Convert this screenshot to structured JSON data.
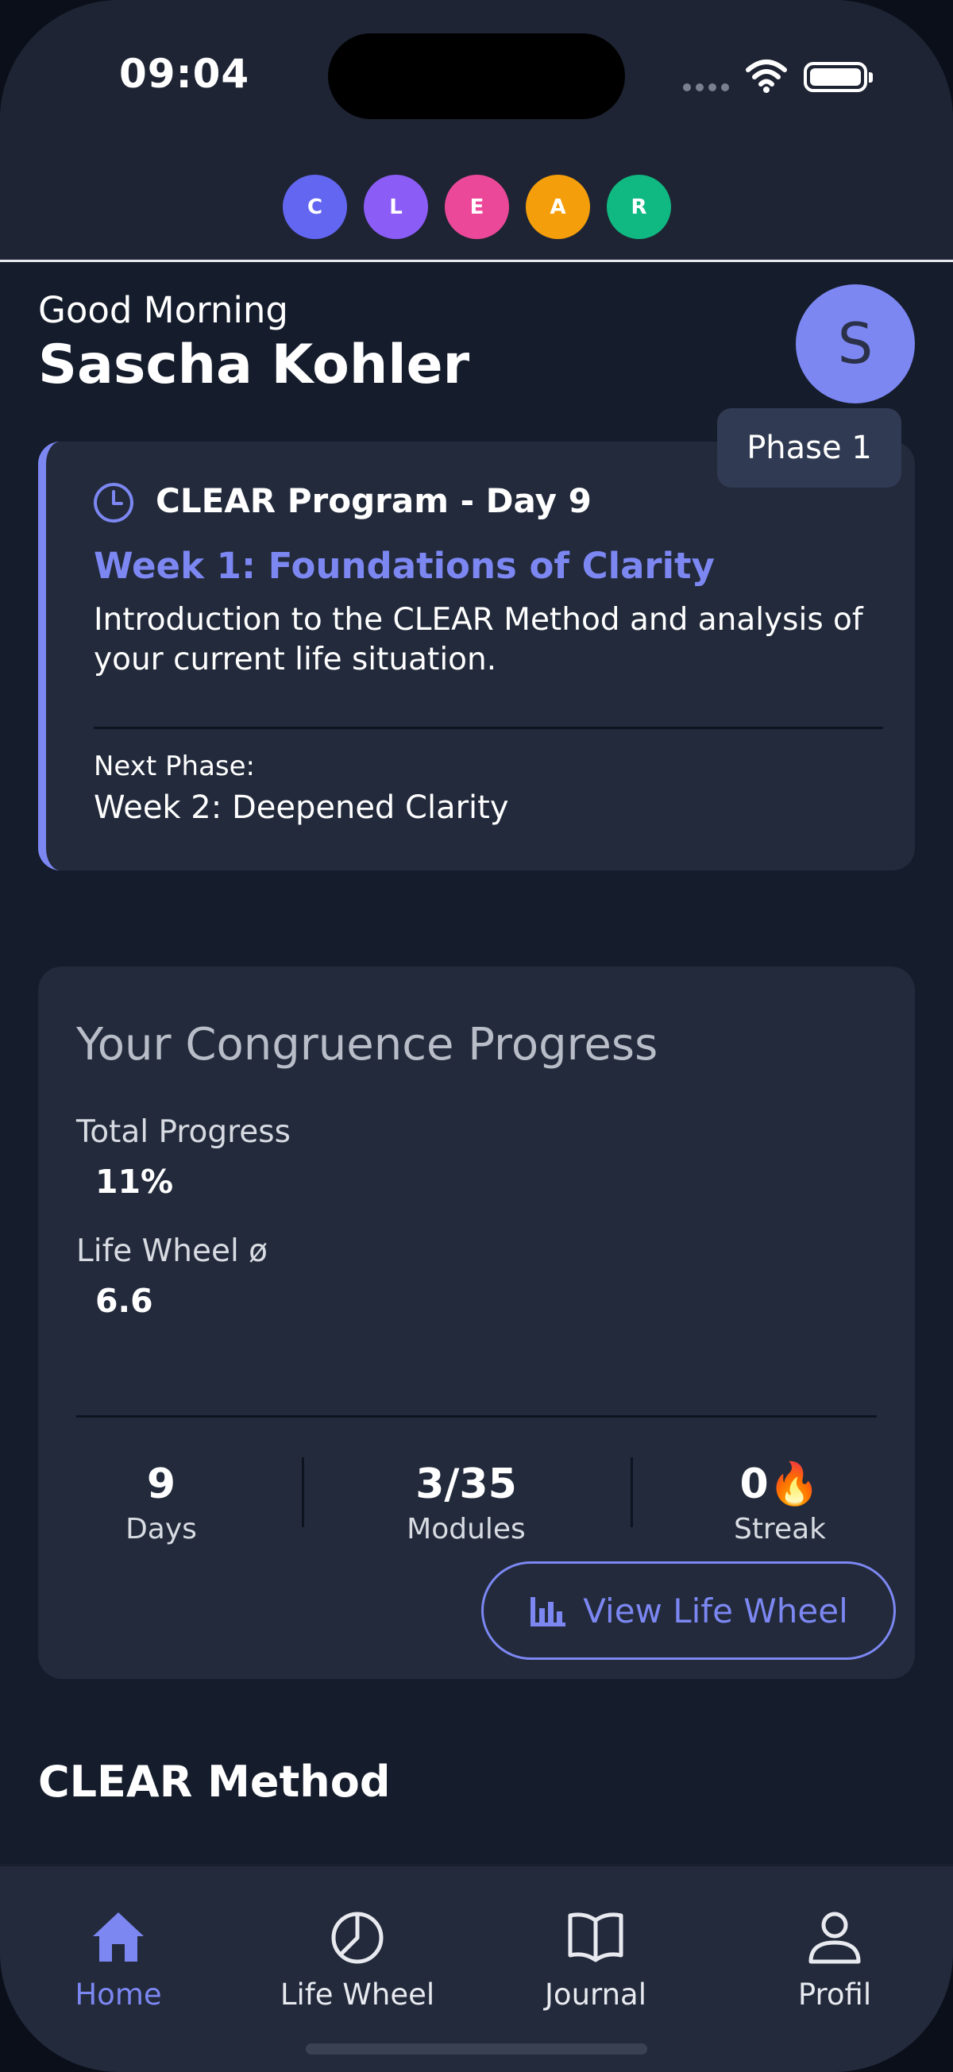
{
  "status_bar": {
    "time": "09:04"
  },
  "method_circles": [
    {
      "letter": "C",
      "color": "#6366f1"
    },
    {
      "letter": "L",
      "color": "#8b5cf6"
    },
    {
      "letter": "E",
      "color": "#ec4899"
    },
    {
      "letter": "A",
      "color": "#f59e0b"
    },
    {
      "letter": "R",
      "color": "#10b981"
    }
  ],
  "user": {
    "greeting": "Good Morning",
    "name": "Sascha Kohler",
    "avatar_initial": "S",
    "phase": "Phase 1"
  },
  "program": {
    "title": "CLEAR Program - Day 9",
    "week_title": "Week 1: Foundations of Clarity",
    "description": "Introduction to the CLEAR Method and analysis of your current life situation.",
    "next_phase_label": "Next Phase:",
    "next_phase_value": "Week 2: Deepened Clarity",
    "icon": "clock-icon"
  },
  "progress": {
    "title": "Your Congruence Progress",
    "total_label": "Total Progress",
    "total_value": "11%",
    "wheel_label": "Life Wheel ø",
    "wheel_value": "6.6",
    "stats": [
      {
        "value": "9",
        "label": "Days"
      },
      {
        "value": "3/35",
        "label": "Modules"
      },
      {
        "value": "0🔥",
        "label": "Streak"
      }
    ],
    "button_label": "View Life Wheel",
    "button_icon": "bar-chart-icon"
  },
  "section_title": "CLEAR Method",
  "tabs": [
    {
      "label": "Home",
      "icon": "home-icon",
      "active": true
    },
    {
      "label": "Life Wheel",
      "icon": "pie-chart-icon",
      "active": false
    },
    {
      "label": "Journal",
      "icon": "book-icon",
      "active": false
    },
    {
      "label": "Profil",
      "icon": "user-icon",
      "active": false
    }
  ],
  "colors": {
    "accent": "#7c87f2",
    "background": "#151c2c",
    "card": "#222a3b"
  }
}
